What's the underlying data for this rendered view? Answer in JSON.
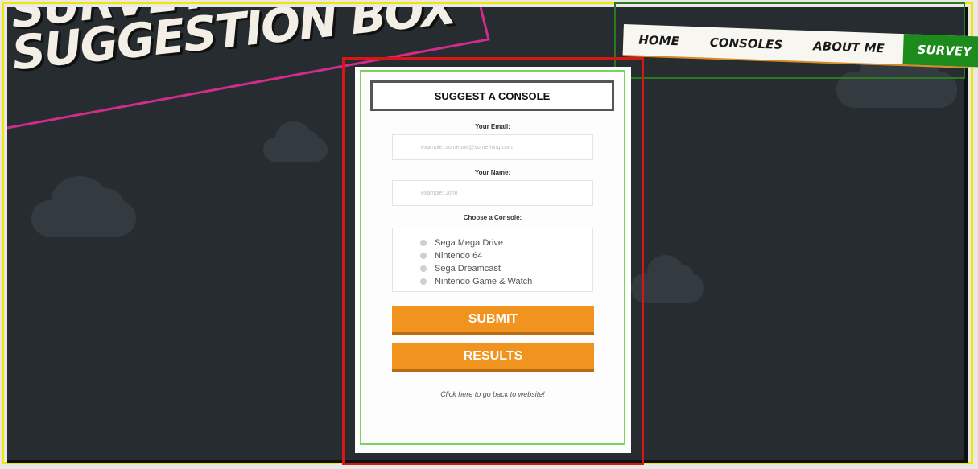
{
  "title": {
    "line1": "SURVEY",
    "line2": "SUGGESTION BOX"
  },
  "nav": {
    "items": [
      {
        "label": "HOME"
      },
      {
        "label": "CONSOLES"
      },
      {
        "label": "ABOUT ME"
      },
      {
        "label": "SURVEY"
      }
    ],
    "active": "SURVEY"
  },
  "form": {
    "heading": "SUGGEST A CONSOLE",
    "email_label": "Your Email:",
    "email_placeholder": "example: someone@something.com",
    "name_label": "Your Name:",
    "name_placeholder": "example: John",
    "console_label": "Choose a Console:",
    "consoles": [
      "Sega Mega Drive",
      "Nintendo 64",
      "Sega Dreamcast",
      "Nintendo Game & Watch"
    ],
    "submit_label": "SUBMIT",
    "results_label": "RESULTS",
    "back_link": "Click here to go back to website!"
  },
  "colors": {
    "background": "#262c30",
    "accent_orange": "#f0941f",
    "nav_active": "#1d8a1c",
    "panel": "#fdfdfd"
  }
}
